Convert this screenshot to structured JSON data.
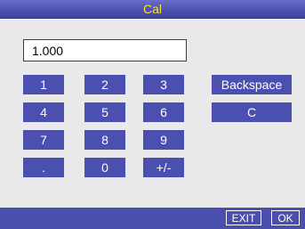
{
  "window": {
    "title": "Cal"
  },
  "display": {
    "value": "1.000"
  },
  "keypad": {
    "k1": "1",
    "k2": "2",
    "k3": "3",
    "k4": "4",
    "k5": "5",
    "k6": "6",
    "k7": "7",
    "k8": "8",
    "k9": "9",
    "dot": ".",
    "k0": "0",
    "sign": "+/-",
    "backspace": "Backspace",
    "clear": "C"
  },
  "softkeys": {
    "exit": "EXIT",
    "ok": "OK"
  },
  "colors": {
    "titlebar": "#4a4fae",
    "title_text": "#ffe12a",
    "key_background": "#4a4fb0",
    "background": "#e9e9e9"
  }
}
